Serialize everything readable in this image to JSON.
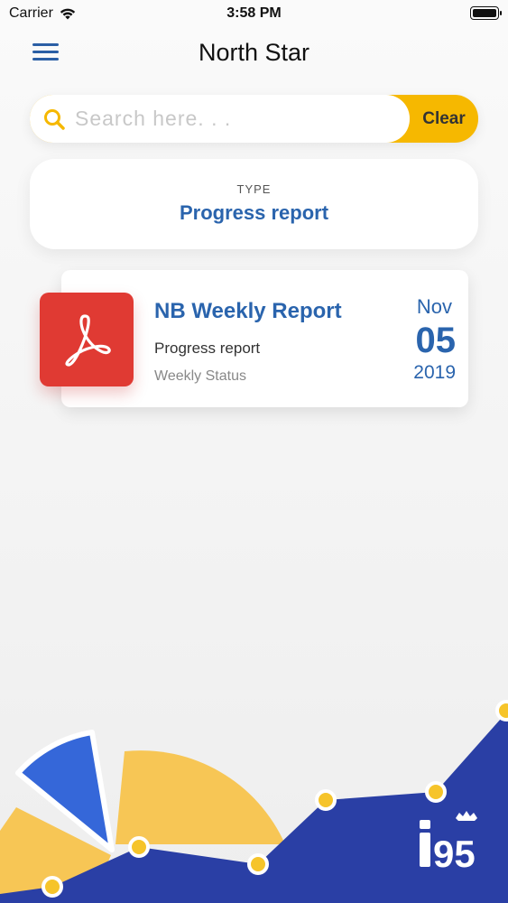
{
  "status_bar": {
    "carrier": "Carrier",
    "time": "3:58 PM"
  },
  "header": {
    "title": "North Star"
  },
  "search": {
    "placeholder": "Search here. . .",
    "value": "",
    "clear_label": "Clear"
  },
  "filter": {
    "label": "TYPE",
    "value": "Progress report"
  },
  "reports": [
    {
      "title": "NB Weekly Report",
      "type": "Progress report",
      "status": "Weekly Status",
      "month": "Nov",
      "day": "05",
      "year": "2019",
      "icon": "pdf-icon"
    }
  ],
  "branding": {
    "logo_text": "i95"
  },
  "colors": {
    "accent_blue": "#2a64ad",
    "accent_yellow": "#f6b800",
    "pdf_red": "#e03a33",
    "navy": "#2a3fa5"
  }
}
